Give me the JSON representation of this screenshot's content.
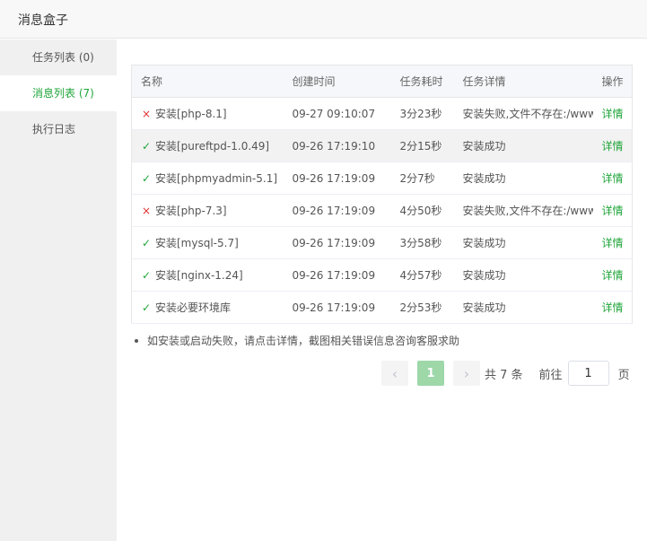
{
  "window": {
    "title": "消息盒子"
  },
  "sidebar": {
    "items": [
      {
        "label": "任务列表 (0)"
      },
      {
        "label": "消息列表 (7)"
      },
      {
        "label": "执行日志"
      }
    ]
  },
  "table": {
    "headers": [
      "名称",
      "创建时间",
      "任务耗时",
      "任务详情",
      "操作"
    ],
    "rows": [
      {
        "status": "fail",
        "name": "安装[php-8.1]",
        "created": "09-27 09:10:07",
        "duration": "3分23秒",
        "detail": "安装失败,文件不存在:/www",
        "op": "详情"
      },
      {
        "status": "ok",
        "name": "安装[pureftpd-1.0.49]",
        "created": "09-26 17:19:10",
        "duration": "2分15秒",
        "detail": "安装成功",
        "op": "详情"
      },
      {
        "status": "ok",
        "name": "安装[phpmyadmin-5.1]",
        "created": "09-26 17:19:09",
        "duration": "2分7秒",
        "detail": "安装成功",
        "op": "详情"
      },
      {
        "status": "fail",
        "name": "安装[php-7.3]",
        "created": "09-26 17:19:09",
        "duration": "4分50秒",
        "detail": "安装失败,文件不存在:/www",
        "op": "详情"
      },
      {
        "status": "ok",
        "name": "安装[mysql-5.7]",
        "created": "09-26 17:19:09",
        "duration": "3分58秒",
        "detail": "安装成功",
        "op": "详情"
      },
      {
        "status": "ok",
        "name": "安装[nginx-1.24]",
        "created": "09-26 17:19:09",
        "duration": "4分57秒",
        "detail": "安装成功",
        "op": "详情"
      },
      {
        "status": "ok",
        "name": "安装必要环境库",
        "created": "09-26 17:19:09",
        "duration": "2分53秒",
        "detail": "安装成功",
        "op": "详情"
      }
    ]
  },
  "tip": "如安装或启动失败，请点击详情，截图相关错误信息咨询客服求助",
  "pagination": {
    "current_page": "1",
    "total_text": "共 7 条",
    "goto_label": "前往",
    "goto_value": "1",
    "page_suffix": "页"
  },
  "icons": {
    "fail": "×",
    "ok": "✓",
    "prev": "‹",
    "next": "›"
  },
  "colors": {
    "accent": "#20a53a",
    "error": "#e02020"
  }
}
